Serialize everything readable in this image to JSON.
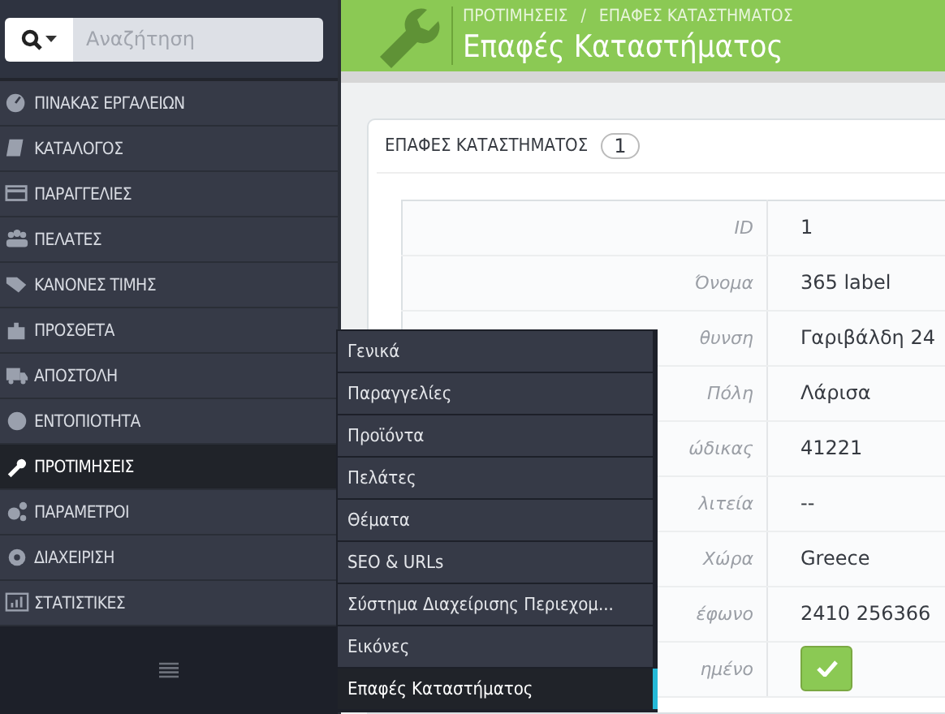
{
  "sidebar": {
    "search": {
      "placeholder": "Αναζήτηση"
    },
    "items": [
      {
        "label": "ΠΙΝΑΚΑΣ ΕΡΓΑΛΕΙΩΝ",
        "selected": false
      },
      {
        "label": "ΚΑΤΑΛΟΓΟΣ",
        "selected": false
      },
      {
        "label": "ΠΑΡΑΓΓΕΛΙΕΣ",
        "selected": false
      },
      {
        "label": "ΠΕΛΑΤΕΣ",
        "selected": false
      },
      {
        "label": "ΚΑΝΟΝΕΣ ΤΙΜΗΣ",
        "selected": false
      },
      {
        "label": "ΠΡΟΣΘΕΤΑ",
        "selected": false
      },
      {
        "label": "ΑΠΟΣΤΟΛΗ",
        "selected": false
      },
      {
        "label": "ΕΝΤΟΠΙΟΤΗΤΑ",
        "selected": false
      },
      {
        "label": "ΠΡΟΤΙΜΗΣΕΙΣ",
        "selected": true
      },
      {
        "label": "ΠΑΡΑΜΕΤΡΟΙ",
        "selected": false
      },
      {
        "label": "ΔΙΑΧΕΙΡΙΣΗ",
        "selected": false
      },
      {
        "label": "ΣΤΑΤΙΣΤΙΚΕΣ",
        "selected": false
      }
    ]
  },
  "submenu": [
    {
      "label": "Γενικά",
      "selected": false
    },
    {
      "label": "Παραγγελίες",
      "selected": false
    },
    {
      "label": "Προϊόντα",
      "selected": false
    },
    {
      "label": "Πελάτες",
      "selected": false
    },
    {
      "label": "Θέματα",
      "selected": false
    },
    {
      "label": "SEO & URLs",
      "selected": false
    },
    {
      "label": "Σύστημα Διαχείρισης Περιεχομ...",
      "selected": false
    },
    {
      "label": "Εικόνες",
      "selected": false
    },
    {
      "label": "Επαφές Καταστήματος",
      "selected": true
    }
  ],
  "header": {
    "breadcrumb": [
      "ΠΡΟΤΙΜΗΣΕΙΣ",
      "ΕΠΑΦΕΣ ΚΑΤΑΣΤΗΜΑΤΟΣ"
    ],
    "breadcrumb_separator": "/",
    "title": "Επαφές Καταστήματος"
  },
  "panel": {
    "title": "ΕΠΑΦΕΣ ΚΑΤΑΣΤΗΜΑΤΟΣ",
    "count": "1",
    "rows": [
      {
        "label": "ID",
        "value": "1"
      },
      {
        "label": "Όνομα",
        "value": "365 label"
      },
      {
        "label": "θυνση",
        "value": "Γαριβάλδη 24"
      },
      {
        "label": "Πόλη",
        "value": "Λάρισα"
      },
      {
        "label": "ώδικας",
        "value": "41221"
      },
      {
        "label": "λιτεία",
        "value": "--"
      },
      {
        "label": "Χώρα",
        "value": "Greece"
      },
      {
        "label": "έφωνο",
        "value": "2410 256366"
      },
      {
        "label": "ημένο",
        "kind": "toggle",
        "checked": true
      }
    ]
  }
}
